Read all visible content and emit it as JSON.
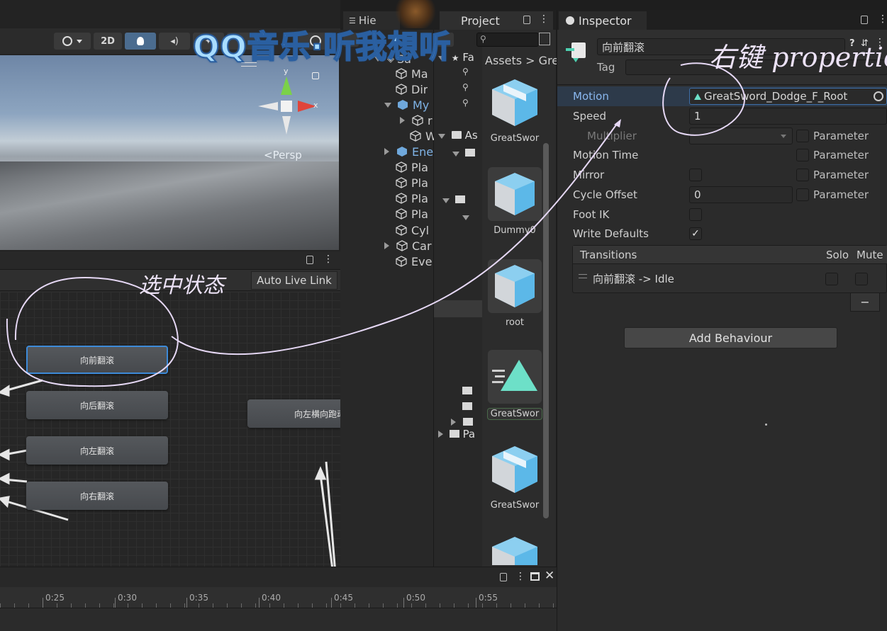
{
  "overlay": {
    "title": "QQ音乐·听我想听",
    "annotation_properties": "右键 properties",
    "annotation_select": "选中状态"
  },
  "scene": {
    "toolbar": {
      "two_d_label": "2D"
    },
    "persp_label": "<Persp",
    "gizmo_y": "y",
    "gizmo_x": "x"
  },
  "animator": {
    "auto_live_link": "Auto Live Link",
    "nodes": [
      "向前翻滚",
      "向后翻滚",
      "向左翻滚",
      "向右翻滚",
      "向左横向跑动"
    ]
  },
  "hierarchy": {
    "tab_label": "Hie",
    "items": [
      "Sa",
      "Ma",
      "Dir",
      "My",
      "r",
      "W",
      "Ene",
      "Pla",
      "Pla",
      "Pla",
      "Pla",
      "Cyl",
      "Car",
      "Eve"
    ]
  },
  "project": {
    "tab_label": "Project",
    "breadcrumb_root": "Assets",
    "breadcrumb_sep": ">",
    "breadcrumb_next": "Gre",
    "tree_favorites": "Fa",
    "tree_assets": "As",
    "tree_packages": "Pa",
    "assets": [
      {
        "label": "GreatSwor",
        "icon": "prefab-icon"
      },
      {
        "label": "Dummy0",
        "icon": "prefab-icon"
      },
      {
        "label": "root",
        "icon": "prefab-icon"
      },
      {
        "label": "GreatSwor",
        "icon": "animation-clip-icon"
      },
      {
        "label": "GreatSwor",
        "icon": "prefab-icon"
      }
    ]
  },
  "inspector": {
    "tab_label": "Inspector",
    "state_name": "向前翻滚",
    "tag_label": "Tag",
    "fields": {
      "motion_label": "Motion",
      "motion_value": "GreatSword_Dodge_F_Root",
      "speed_label": "Speed",
      "speed_value": "1",
      "multiplier_label": "Multiplier",
      "motion_time_label": "Motion Time",
      "mirror_label": "Mirror",
      "cycle_offset_label": "Cycle Offset",
      "cycle_offset_value": "0",
      "foot_ik_label": "Foot IK",
      "write_defaults_label": "Write Defaults",
      "parameter_label": "Parameter",
      "write_defaults_checked": true
    },
    "transitions": {
      "header": "Transitions",
      "solo": "Solo",
      "mute": "Mute",
      "items": [
        "向前翻滚 -> Idle"
      ],
      "minus": "−"
    },
    "add_behaviour": "Add Behaviour"
  },
  "timeline": {
    "ticks": [
      "0:25",
      "0:30",
      "0:35",
      "0:40",
      "0:45",
      "0:50",
      "0:55"
    ]
  },
  "colors": {
    "accent_blue": "#3d8ad8",
    "motion_highlight": "#2d4a6e",
    "annotation": "#e6d8f5",
    "overlay_text": "#9fd4ff"
  }
}
